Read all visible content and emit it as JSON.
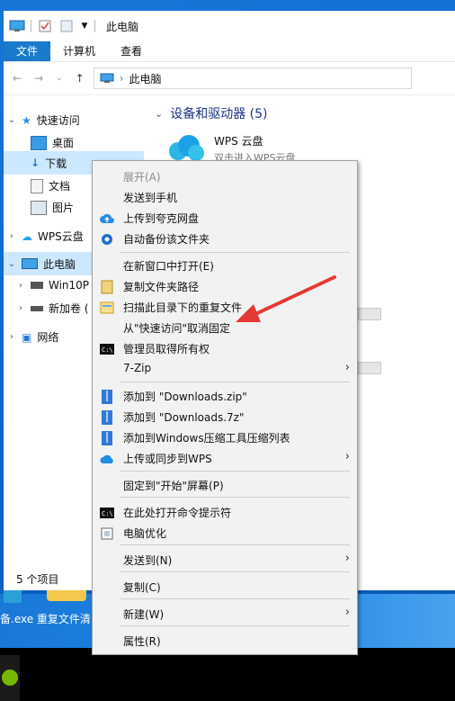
{
  "window": {
    "title": "此电脑",
    "ribbon_tabs": [
      "文件",
      "计算机",
      "查看"
    ],
    "address_path": "此电脑",
    "status": "5 个项目"
  },
  "nav": {
    "quick_access": "快速访问",
    "items": [
      "桌面",
      "下载",
      "文档",
      "图片"
    ],
    "wps_cloud": "WPS云盘",
    "this_pc": "此电脑",
    "drives": [
      "Win10P",
      "新加卷 ("
    ],
    "network": "网络"
  },
  "content": {
    "section_title": "设备和驱动器 (5)",
    "wps_drive_name": "WPS 云盘",
    "wps_drive_desc": "双击进入WPS云盘"
  },
  "desktop": {
    "label": "备.exe 重复文件清"
  },
  "menu": {
    "items": [
      {
        "label": "展开(A)",
        "disabled": true,
        "icon": "none"
      },
      {
        "label": "发送到手机",
        "icon": "none"
      },
      {
        "label": "上传到夸克网盘",
        "icon": "cloud-upload-icon"
      },
      {
        "label": "自动备份该文件夹",
        "icon": "backup-icon"
      },
      {
        "label": "在新窗口中打开(E)",
        "icon": "none"
      },
      {
        "label": "复制文件夹路径",
        "icon": "copy-path-icon"
      },
      {
        "label": "扫描此目录下的重复文件",
        "icon": "scan-icon"
      },
      {
        "label": "从\"快速访问\"取消固定",
        "icon": "none"
      },
      {
        "label": "管理员取得所有权",
        "icon": "cmd-icon"
      },
      {
        "label": "7-Zip",
        "icon": "none",
        "submenu": true
      },
      {
        "label": "添加到 \"Downloads.zip\"",
        "icon": "zip-icon"
      },
      {
        "label": "添加到 \"Downloads.7z\"",
        "icon": "zip-icon"
      },
      {
        "label": "添加到Windows压缩工具压缩列表",
        "icon": "zip-icon"
      },
      {
        "label": "上传或同步到WPS",
        "icon": "wps-cloud-icon",
        "submenu": true
      },
      {
        "label": "固定到\"开始\"屏幕(P)",
        "icon": "none"
      },
      {
        "label": "在此处打开命令提示符",
        "icon": "cmd-icon"
      },
      {
        "label": "电脑优化",
        "icon": "optimize-icon"
      },
      {
        "label": "发送到(N)",
        "icon": "none",
        "submenu": true
      },
      {
        "label": "复制(C)",
        "icon": "none"
      },
      {
        "label": "新建(W)",
        "icon": "none",
        "submenu": true
      },
      {
        "label": "属性(R)",
        "icon": "none"
      }
    ]
  },
  "colors": {
    "accent": "#1979ca",
    "arrow": "#e53935",
    "section_title": "#1e3287"
  }
}
